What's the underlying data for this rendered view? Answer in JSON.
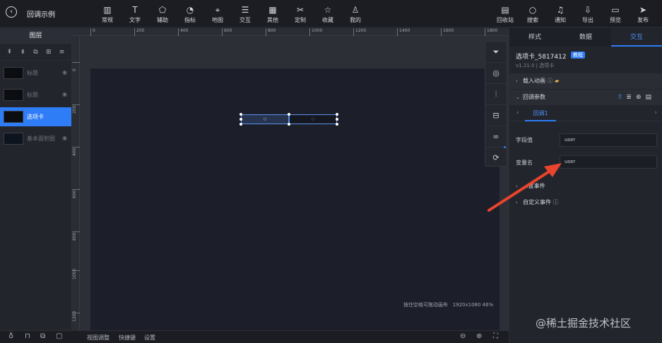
{
  "header": {
    "back_icon": "arrow-left-icon",
    "title": "回调示例",
    "tools": [
      {
        "label": "常规",
        "icon": "bar-chart-icon",
        "glyph": "▥"
      },
      {
        "label": "文字",
        "icon": "text-icon",
        "glyph": "T"
      },
      {
        "label": "辅助",
        "icon": "shapes-icon",
        "glyph": "⬠"
      },
      {
        "label": "指标",
        "icon": "indicator-icon",
        "glyph": "◔"
      },
      {
        "label": "地图",
        "icon": "map-pin-icon",
        "glyph": "⌖"
      },
      {
        "label": "交互",
        "icon": "sliders-icon",
        "glyph": "☰"
      },
      {
        "label": "其他",
        "icon": "grid-icon",
        "glyph": "▦"
      },
      {
        "label": "定制",
        "icon": "tools-icon",
        "glyph": "✂"
      },
      {
        "label": "收藏",
        "icon": "star-icon",
        "glyph": "☆"
      },
      {
        "label": "我的",
        "icon": "user-icon",
        "glyph": "♙"
      }
    ],
    "right_tools": [
      {
        "label": "回收站",
        "icon": "trash-icon",
        "glyph": "🗑"
      },
      {
        "label": "搜索",
        "icon": "search-icon",
        "glyph": "⌕"
      },
      {
        "label": "通知",
        "icon": "bell-icon",
        "glyph": "🔔"
      },
      {
        "label": "导出",
        "icon": "export-icon",
        "glyph": "⇩"
      },
      {
        "label": "预览",
        "icon": "preview-icon",
        "glyph": "▭"
      },
      {
        "label": "发布",
        "icon": "send-icon",
        "glyph": "➤"
      }
    ]
  },
  "layers": {
    "title": "图层",
    "items": [
      {
        "name": "标题",
        "icon": "eye-icon",
        "active": false
      },
      {
        "name": "标题",
        "icon": "eye-icon",
        "active": false
      },
      {
        "name": "选项卡",
        "icon": "",
        "active": true
      },
      {
        "name": "基本面积图",
        "icon": "eye-icon",
        "active": false
      }
    ]
  },
  "ruler": {
    "h_ticks": [
      "0",
      "200",
      "400",
      "600",
      "800",
      "1000",
      "1200",
      "1400",
      "1600",
      "1800"
    ],
    "v_ticks": [
      "0",
      "200",
      "400",
      "600",
      "800",
      "1000",
      "1200"
    ]
  },
  "canvas": {
    "hint": "按住空格可拖动画布",
    "size_info": "1920x1080 46%",
    "tab1": "○",
    "tab2": "○"
  },
  "bottom": {
    "view_adjust": "视图调整",
    "shortcuts": "快捷键",
    "settings": "设置"
  },
  "right_panel": {
    "tabs": [
      "样式",
      "数据",
      "交互"
    ],
    "component_name": "选项卡_5817412",
    "tutorial_badge": "教程",
    "version": "v1.21.0 | 选项卡",
    "sections": {
      "load_animation": "载入动画",
      "callback_params": "回调参数",
      "event_blank": "...置事件",
      "custom_event": "自定义事件"
    },
    "callback_tab": "回调1",
    "fields": [
      {
        "label": "字段值",
        "value": "user"
      },
      {
        "label": "变量名",
        "value": "user"
      }
    ]
  },
  "watermark": "@稀土掘金技术社区",
  "colors": {
    "accent": "#2f7df6",
    "arrow": "#e8442e"
  }
}
